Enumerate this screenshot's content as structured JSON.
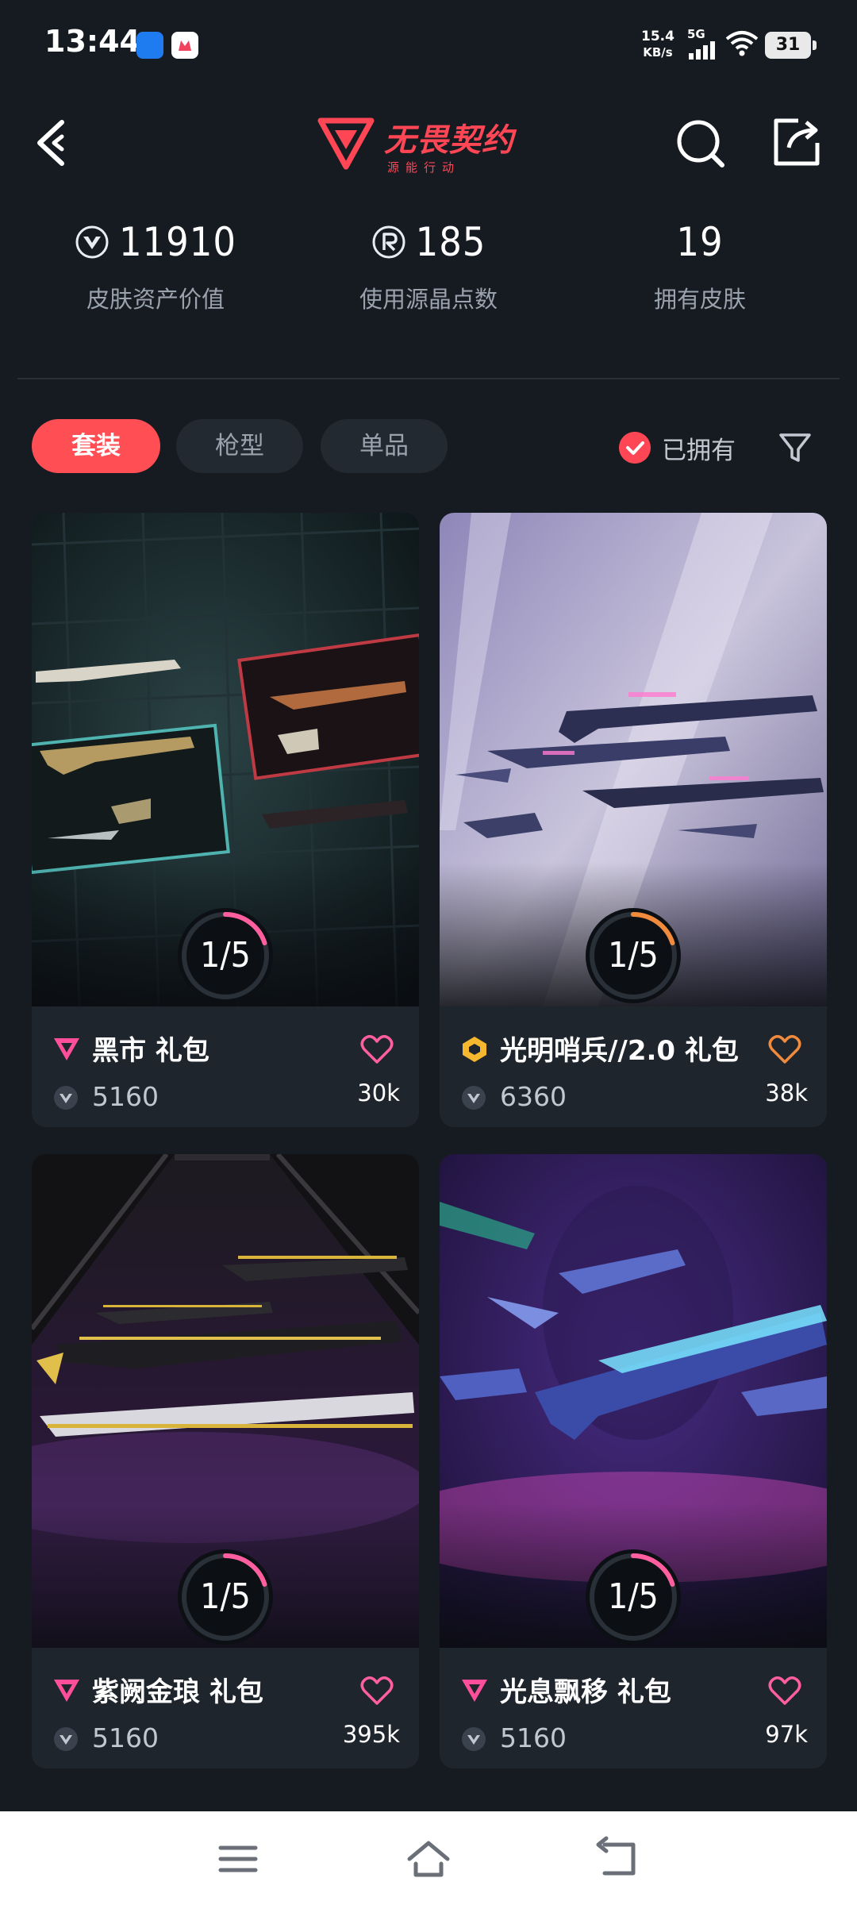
{
  "status_bar": {
    "time": "13:44",
    "network_speed": "15.4",
    "network_unit": "KB/s",
    "network_type": "5G",
    "battery": "31"
  },
  "header": {
    "back_icon": "chevron-left-icon",
    "logo_title": "无畏契约",
    "logo_subtitle": "源能行动",
    "search_icon": "search-icon",
    "share_icon": "share-icon"
  },
  "stats": [
    {
      "icon": "vp-coin-icon",
      "value": "11910",
      "label": "皮肤资产价值"
    },
    {
      "icon": "radianite-icon",
      "value": "185",
      "label": "使用源晶点数"
    },
    {
      "icon": "",
      "value": "19",
      "label": "拥有皮肤"
    }
  ],
  "filters": {
    "tabs": [
      {
        "label": "套装",
        "active": true
      },
      {
        "label": "枪型",
        "active": false
      },
      {
        "label": "单品",
        "active": false
      }
    ],
    "owned_label": "已拥有",
    "owned_checked": true,
    "filter_icon": "funnel-icon"
  },
  "cards": [
    {
      "title": "黑市 礼包",
      "tier": "premium",
      "tier_color": "#ff4f9a",
      "price": "5160",
      "likes": "30k",
      "progress": "1/5",
      "progress_fraction": 0.2,
      "accent": "#ff5f9e"
    },
    {
      "title": "光明哨兵//2.0 礼包",
      "tier": "exclusive",
      "tier_color": "#f5b82e",
      "price": "6360",
      "likes": "38k",
      "progress": "1/5",
      "progress_fraction": 0.2,
      "accent": "#f08a3c"
    },
    {
      "title": "紫阙金琅 礼包",
      "tier": "premium",
      "tier_color": "#ff4f9a",
      "price": "5160",
      "likes": "395k",
      "progress": "1/5",
      "progress_fraction": 0.2,
      "accent": "#ff5f9e"
    },
    {
      "title": "光息飘移 礼包",
      "tier": "premium",
      "tier_color": "#ff4f9a",
      "price": "5160",
      "likes": "97k",
      "progress": "1/5",
      "progress_fraction": 0.2,
      "accent": "#ff5f9e"
    }
  ],
  "nav_bar": {
    "menu_icon": "menu-icon",
    "home_icon": "home-icon",
    "back_icon": "back-icon"
  },
  "colors": {
    "background": "#161b22",
    "brand_red": "#ff4655",
    "card": "#1f252d"
  }
}
